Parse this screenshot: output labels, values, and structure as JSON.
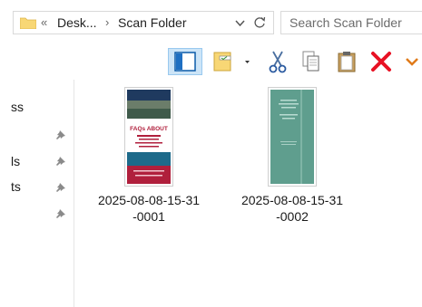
{
  "address_bar": {
    "overflow": "«",
    "crumbs": [
      "Desk...",
      "Scan Folder"
    ],
    "separator": "›"
  },
  "search": {
    "placeholder": "Search Scan Folder"
  },
  "nav_pane": {
    "items": [
      {
        "text": "ss",
        "pinned": false
      },
      {
        "text": "",
        "pinned": true
      },
      {
        "text": "ls",
        "pinned": true
      },
      {
        "text": "ts",
        "pinned": true
      },
      {
        "text": "",
        "pinned": true
      }
    ]
  },
  "files": [
    {
      "name": "2025-08-08-15-31\n-0001",
      "thumb_text": [
        "FAQs ABOUT"
      ],
      "thumb_colors": {
        "top": "#1f3a5f",
        "accent": "#b01f3c",
        "band": "#1d6a8a"
      }
    },
    {
      "name": "2025-08-08-15-31\n-0002",
      "thumb_colors": {
        "bg": "#5f9e8e"
      }
    }
  ],
  "colors": {
    "accent_blue": "#0078d7",
    "delete_red": "#e81123",
    "folder_yellow": "#f8d775"
  }
}
